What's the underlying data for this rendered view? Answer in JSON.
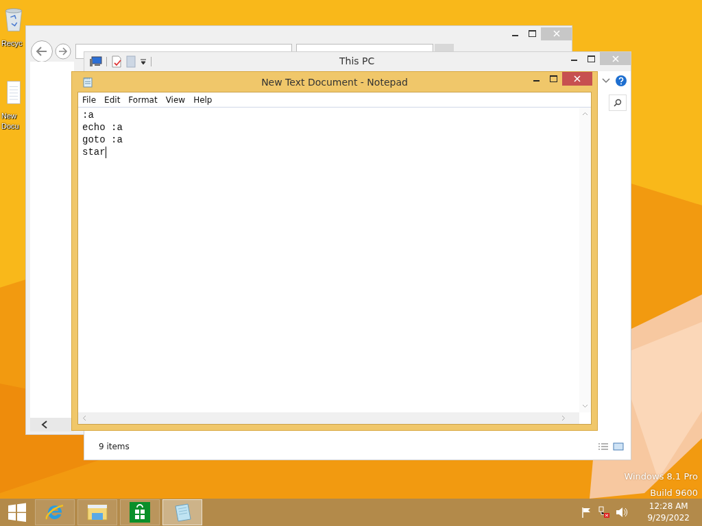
{
  "desktop": {
    "icons": [
      {
        "kind": "recycle-bin",
        "label_lines": [
          "Recyc"
        ]
      },
      {
        "kind": "document",
        "label_lines": [
          "New",
          "Docu"
        ]
      }
    ],
    "watermark": [
      "Windows 8.1 Pro",
      "Build 9600"
    ]
  },
  "browser_window": {
    "kind": "browser"
  },
  "explorer_window": {
    "title": "This PC",
    "status": "9 items"
  },
  "notepad": {
    "title": "New Text Document - Notepad",
    "menu": [
      "File",
      "Edit",
      "Format",
      "View",
      "Help"
    ],
    "lines": [
      {
        "text": ":a",
        "caret": false
      },
      {
        "text": "echo :a",
        "caret": false
      },
      {
        "text": "goto :a",
        "caret": false
      },
      {
        "text": "star",
        "caret": true
      }
    ]
  },
  "taskbar": {
    "items": [
      {
        "kind": "ie",
        "selected": false
      },
      {
        "kind": "explorer",
        "selected": false
      },
      {
        "kind": "store",
        "selected": false
      },
      {
        "kind": "notepad",
        "selected": true
      }
    ],
    "time": "12:28 AM",
    "date": "9/29/2022"
  }
}
